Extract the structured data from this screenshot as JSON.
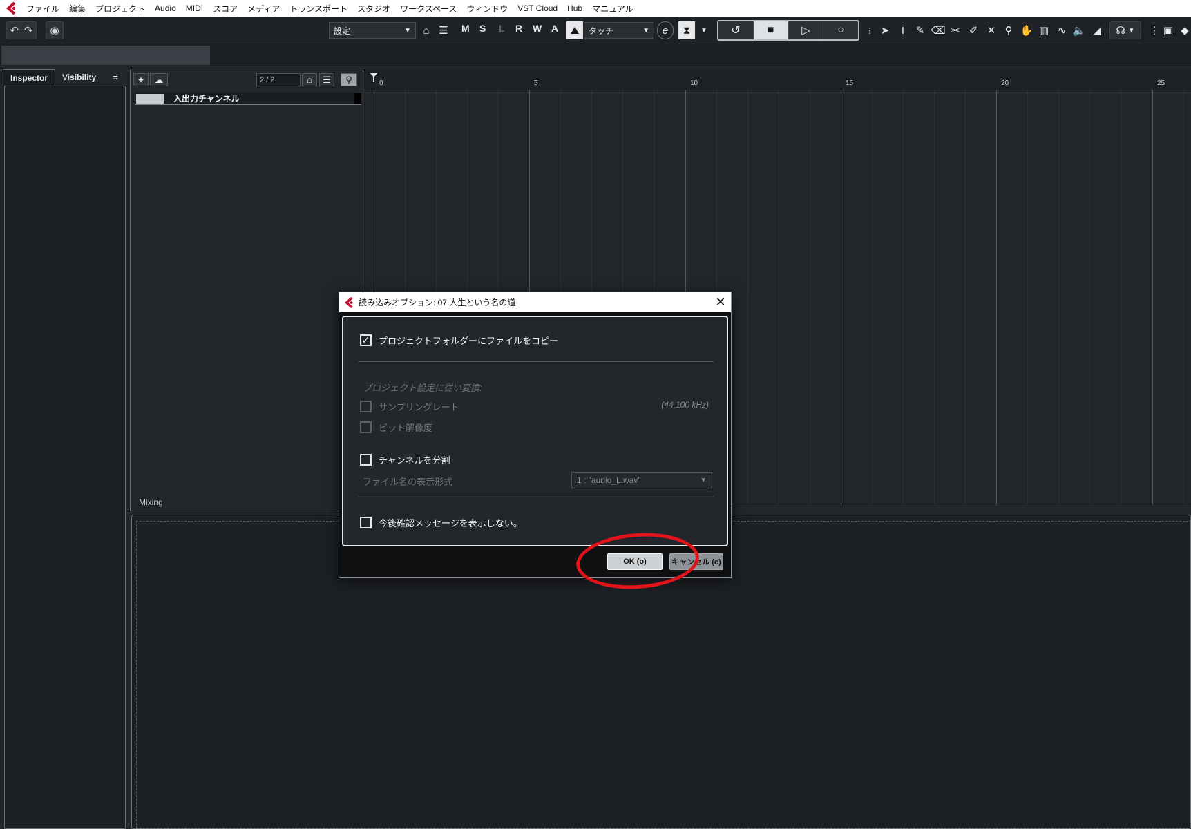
{
  "menubar": {
    "items": [
      "ファイル",
      "編集",
      "プロジェクト",
      "Audio",
      "MIDI",
      "スコア",
      "メディア",
      "トランスポート",
      "スタジオ",
      "ワークスペース",
      "ウィンドウ",
      "VST Cloud",
      "Hub",
      "マニュアル"
    ]
  },
  "toolbar": {
    "preset": "設定",
    "msl": [
      "M",
      "S",
      "L",
      "R",
      "W",
      "A"
    ],
    "automation_mode": "タッチ",
    "automation_icon": "e"
  },
  "inspector": {
    "tabs": [
      "Inspector",
      "Visibility"
    ],
    "menu_glyph": "="
  },
  "tracklist": {
    "count": "2 / 2",
    "track_name": "入出力チャンネル",
    "mixing_label": "Mixing"
  },
  "ruler": {
    "labels": [
      "0",
      "5",
      "10",
      "15",
      "20",
      "25"
    ]
  },
  "dialog": {
    "title": "読み込みオプション: 07.人生という名の道",
    "copy_files_label": "プロジェクトフォルダーにファイルをコピー",
    "copy_files_checked": true,
    "convert_section": "プロジェクト設定に従い変換:",
    "sample_rate_label": "サンプリングレート",
    "sample_rate_value": "(44.100 kHz)",
    "bit_depth_label": "ビット解像度",
    "split_channels_label": "チャンネルを分割",
    "filename_format_label": "ファイル名の表示形式",
    "filename_format_value": "1 : \"audio_L.wav\"",
    "dont_show_label": "今後確認メッセージを表示しない。",
    "ok_label": "OK (o)",
    "cancel_label": "キャンセル (c)"
  },
  "colors": {
    "background": "#23272b",
    "annotation": "#e0141a",
    "brand": "#c8102e"
  }
}
